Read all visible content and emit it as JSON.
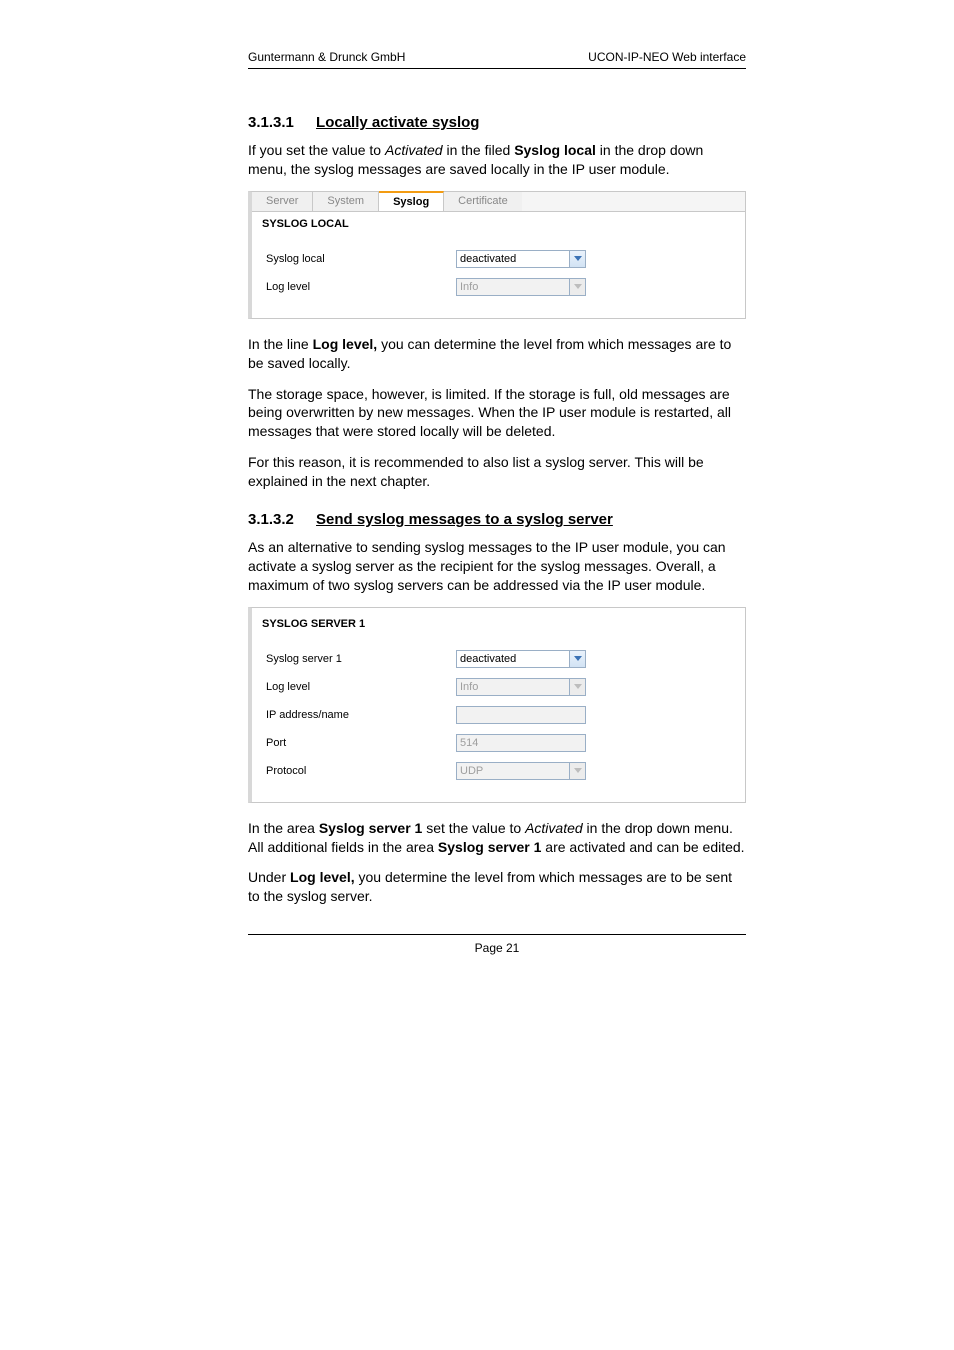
{
  "header": {
    "left": "Guntermann & Drunck GmbH",
    "right": "UCON-IP-NEO Web interface"
  },
  "section1": {
    "number": "3.1.3.1",
    "title": "Locally activate syslog",
    "para1_a": "If you set the value to ",
    "para1_b": "Activated",
    "para1_c": " in the filed ",
    "para1_d": "Syslog local",
    "para1_e": " in the drop down menu, the syslog messages are saved locally in the IP user module."
  },
  "panel1": {
    "tabs": {
      "server": "Server",
      "system": "System",
      "syslog": "Syslog",
      "certificate": "Certificate"
    },
    "title": "SYSLOG LOCAL",
    "rows": {
      "syslog_local_label": "Syslog local",
      "syslog_local_value": "deactivated",
      "log_level_label": "Log level",
      "log_level_value": "Info"
    }
  },
  "after_panel1": {
    "p1_a": "In the line ",
    "p1_b": "Log level,",
    "p1_c": " you can determine the level from which messages are to be saved locally.",
    "p2": "The storage space, however, is limited. If the storage is full, old messages are being overwritten by new messages. When the IP user module is restarted, all messages that were stored locally will be deleted.",
    "p3": "For this reason, it is recommended to also list a syslog server. This will be explained in the next chapter."
  },
  "section2": {
    "number": "3.1.3.2",
    "title": "Send syslog messages to a syslog server",
    "para1": "As an alternative to sending syslog messages to the IP user module, you can activate a syslog server as the recipient for the syslog messages. Overall, a maximum of two syslog servers can be addressed via the IP user module."
  },
  "panel2": {
    "title": "SYSLOG SERVER 1",
    "rows": {
      "syslog_server_label": "Syslog server 1",
      "syslog_server_value": "deactivated",
      "log_level_label": "Log level",
      "log_level_value": "Info",
      "ip_label": "IP address/name",
      "ip_value": "",
      "port_label": "Port",
      "port_value": "514",
      "protocol_label": "Protocol",
      "protocol_value": "UDP"
    }
  },
  "after_panel2": {
    "p1_a": "In the area ",
    "p1_b": "Syslog server 1",
    "p1_c": " set the value to ",
    "p1_d": "Activated",
    "p1_e": " in the drop down menu. All additional fields in the area ",
    "p1_f": "Syslog server 1",
    "p1_g": " are activated and can be edited.",
    "p2_a": "Under ",
    "p2_b": "Log level,",
    "p2_c": " you determine the level from which messages are to be sent to the syslog server."
  },
  "footer": {
    "page": "Page 21"
  }
}
